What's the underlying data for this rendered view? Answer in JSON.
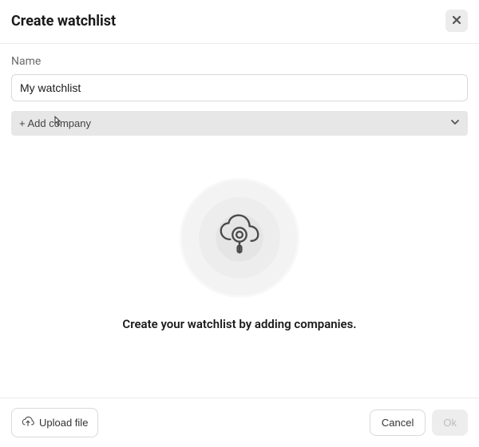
{
  "header": {
    "title": "Create watchlist"
  },
  "form": {
    "name_label": "Name",
    "name_value": "My watchlist",
    "add_company_label": "+ Add company"
  },
  "empty_state": {
    "message": "Create your watchlist by adding companies."
  },
  "footer": {
    "upload_label": "Upload file",
    "cancel_label": "Cancel",
    "ok_label": "Ok"
  }
}
